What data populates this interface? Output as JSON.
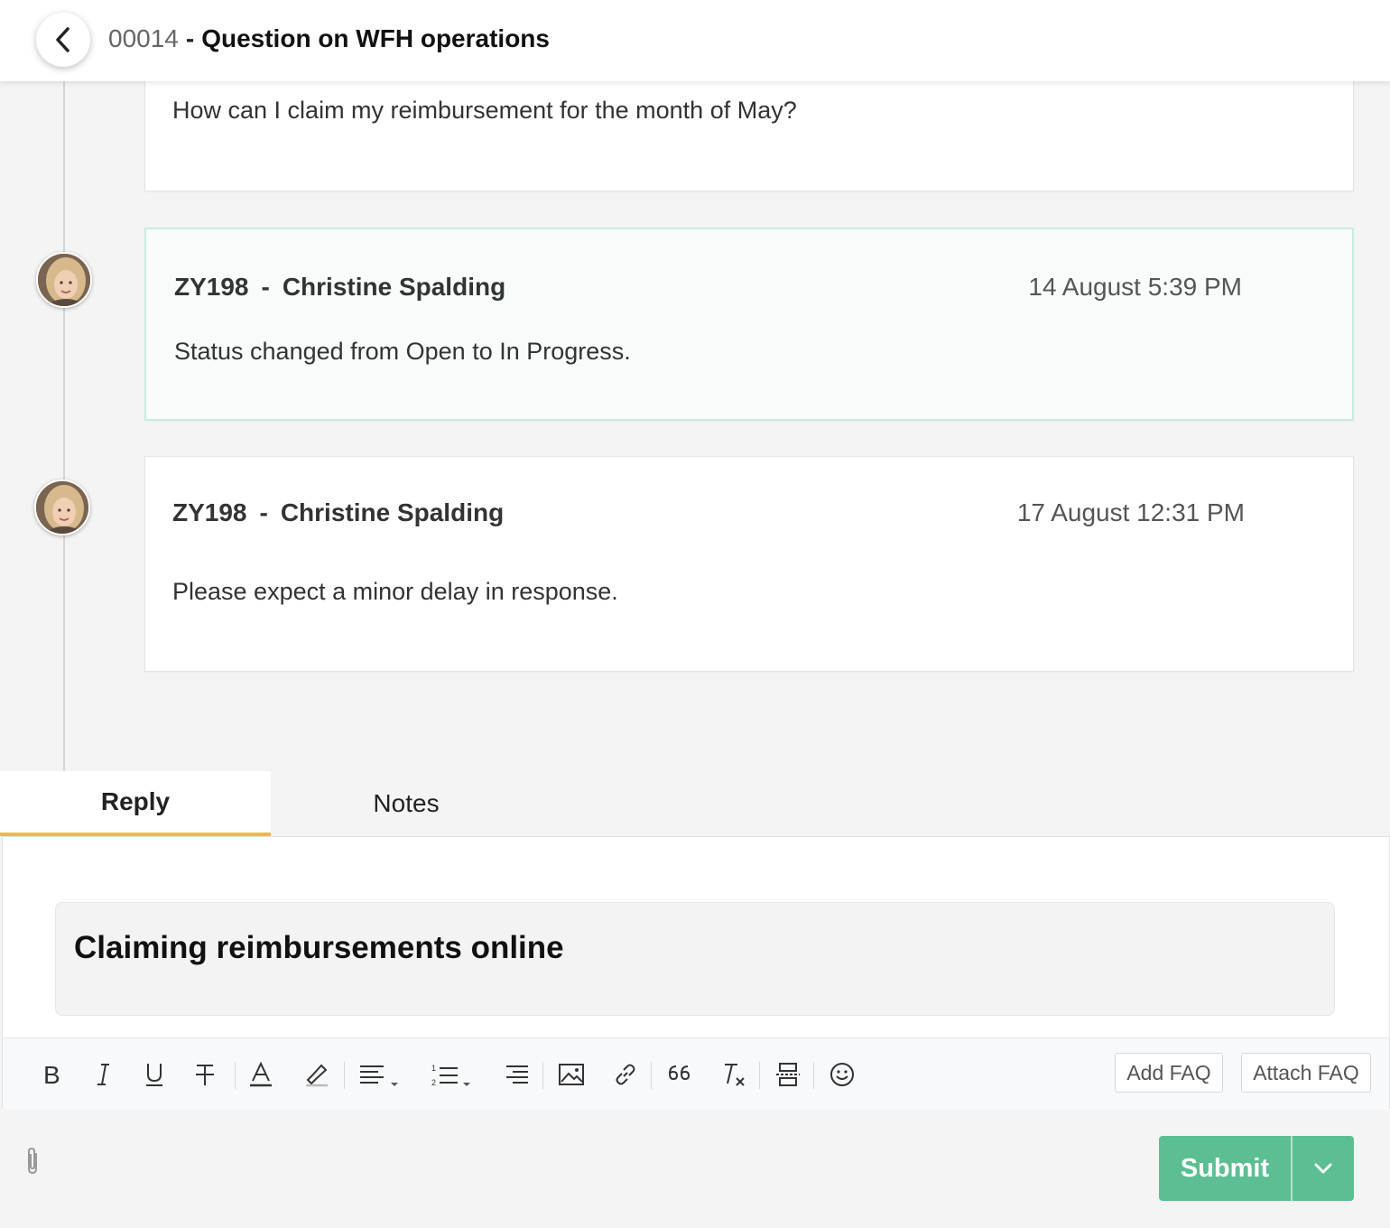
{
  "header": {
    "ticket_id": "00014",
    "separator": "-",
    "subject": "Question on WFH operations"
  },
  "thread": [
    {
      "text": "How can I claim my reimbursement for the month of May?"
    },
    {
      "agent_id": "ZY198",
      "dash": "-",
      "agent_name": "Christine Spalding",
      "timestamp": "14 August 5:39 PM",
      "text": "Status changed from Open to In Progress."
    },
    {
      "agent_id": "ZY198",
      "dash": "-",
      "agent_name": "Christine Spalding",
      "timestamp": "17 August 12:31 PM",
      "text": "Please expect a minor delay in response."
    }
  ],
  "tabs": {
    "reply": "Reply",
    "notes": "Notes",
    "active": "Reply"
  },
  "editor": {
    "subject": "Claiming reimbursements online",
    "toolbar": [
      "bold-icon",
      "italic-icon",
      "underline-icon",
      "strikethrough-icon",
      "font-color-icon",
      "highlight-icon",
      "align-icon",
      "numbered-list-icon",
      "indent-icon",
      "image-icon",
      "link-icon",
      "quote-icon",
      "clear-format-icon",
      "insert-snippet-icon",
      "emoji-icon"
    ],
    "add_faq": "Add FAQ",
    "attach_faq": "Attach FAQ"
  },
  "footer": {
    "submit": "Submit"
  },
  "colors": {
    "accent_tab": "#f0b84a",
    "submit": "#5cbf92",
    "highlight_card_bg": "#f7fcfb",
    "highlight_card_border": "#c9ece0"
  }
}
